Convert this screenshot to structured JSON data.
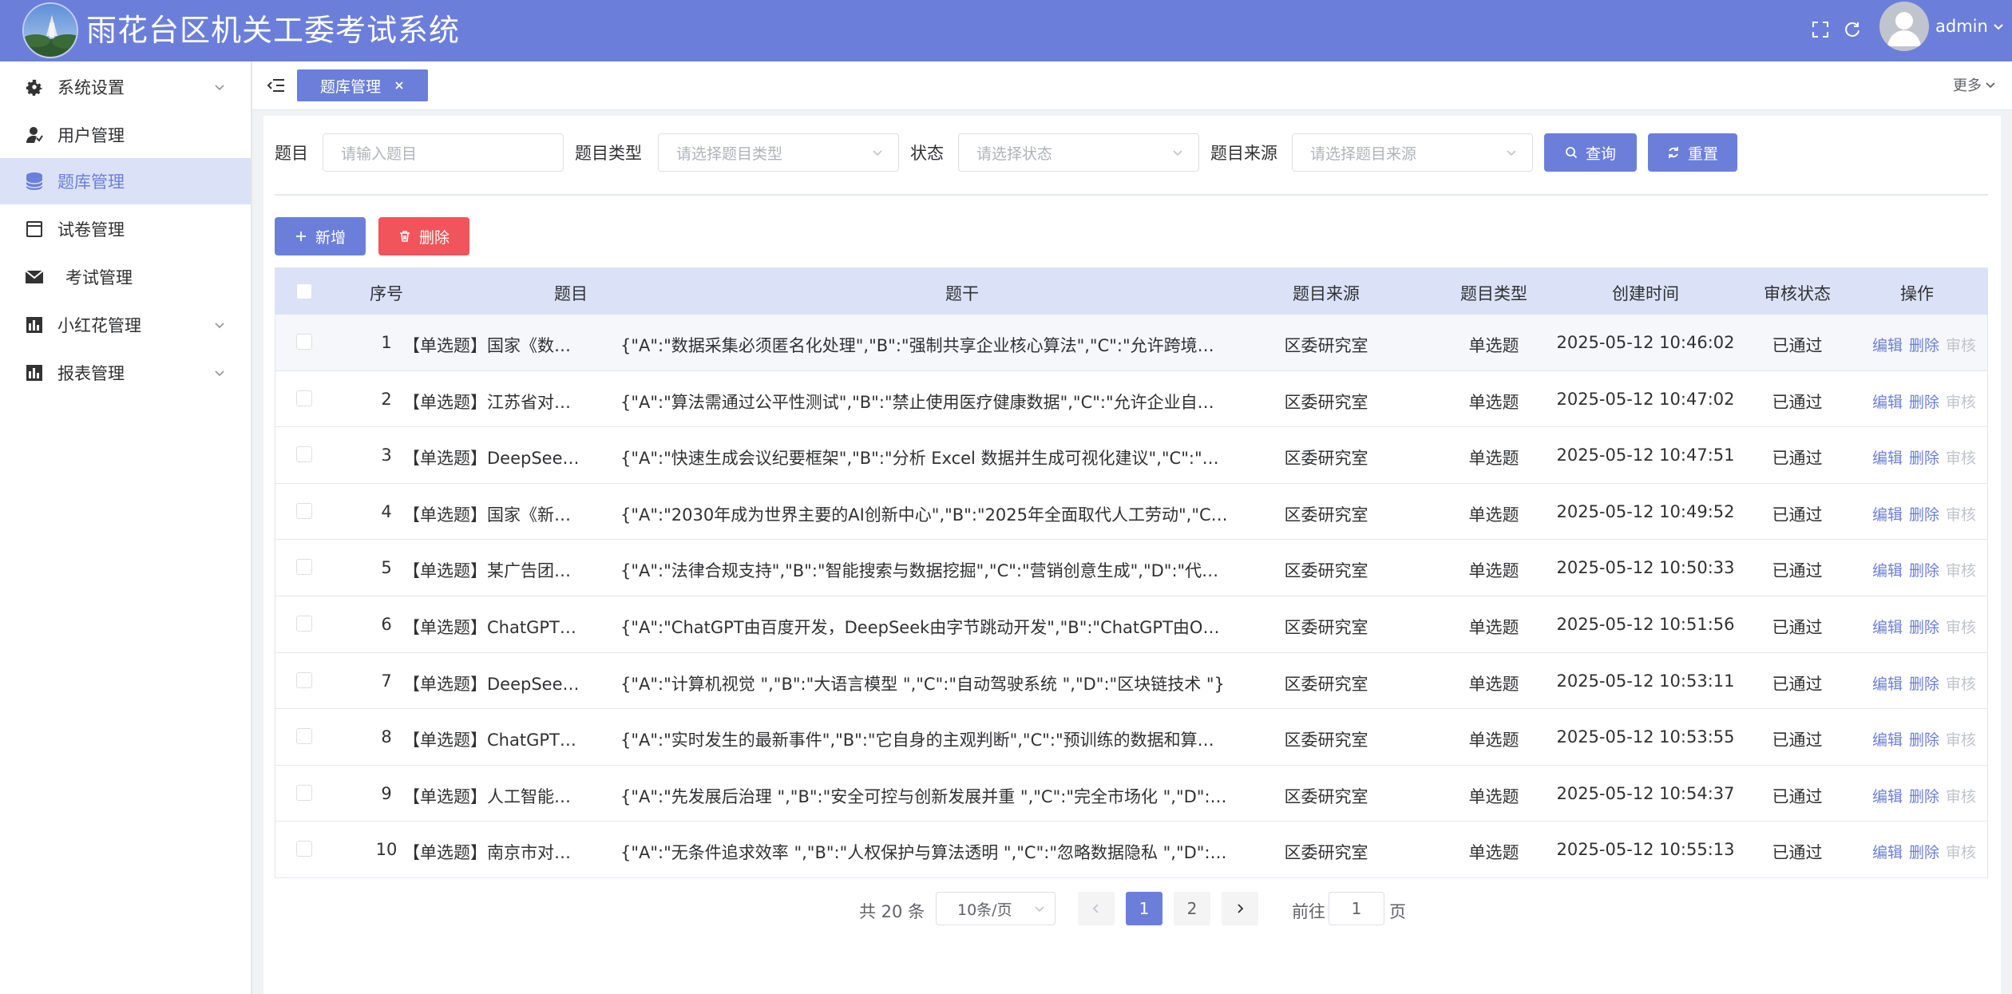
{
  "header": {
    "title": "雨花台区机关工委考试系统",
    "user": "admin"
  },
  "sidebar": {
    "items": [
      {
        "label": "系统设置",
        "icon": "gear-icon",
        "has_arrow": true
      },
      {
        "label": "用户管理",
        "icon": "user-icon",
        "has_arrow": false
      },
      {
        "label": "题库管理",
        "icon": "database-icon",
        "has_arrow": false,
        "active": true
      },
      {
        "label": "试卷管理",
        "icon": "calendar-icon",
        "has_arrow": false
      },
      {
        "label": "考试管理",
        "icon": "mail-icon",
        "has_arrow": false
      },
      {
        "label": "小红花管理",
        "icon": "bar-chart-icon",
        "has_arrow": true
      },
      {
        "label": "报表管理",
        "icon": "bar-chart-icon",
        "has_arrow": true
      }
    ]
  },
  "tabs": {
    "active": "题库管理",
    "more": "更多"
  },
  "filters": {
    "title_label": "题目",
    "title_placeholder": "请输入题目",
    "type_label": "题目类型",
    "type_placeholder": "请选择题目类型",
    "status_label": "状态",
    "status_placeholder": "请选择状态",
    "source_label": "题目来源",
    "source_placeholder": "请选择题目来源",
    "query_label": "查询",
    "reset_label": "重置"
  },
  "actions": {
    "add_label": "新增",
    "delete_label": "删除"
  },
  "table": {
    "headers": [
      "序号",
      "题目",
      "题干",
      "题目来源",
      "题目类型",
      "创建时间",
      "审核状态",
      "操作"
    ],
    "op_labels": {
      "edit": "编辑",
      "delete": "删除",
      "audit": "审核"
    },
    "rows": [
      {
        "no": "1",
        "title": "【单选题】国家《数…",
        "stem": "{\"A\":\"数据采集必须匿名化处理\",\"B\":\"强制共享企业核心算法\",\"C\":\"允许跨境…",
        "source": "区委研究室",
        "type": "单选题",
        "time": "2025-05-12 10:46:02",
        "status": "已通过"
      },
      {
        "no": "2",
        "title": "【单选题】江苏省对…",
        "stem": "{\"A\":\"算法需通过公平性测试\",\"B\":\"禁止使用医疗健康数据\",\"C\":\"允许企业自…",
        "source": "区委研究室",
        "type": "单选题",
        "time": "2025-05-12 10:47:02",
        "status": "已通过"
      },
      {
        "no": "3",
        "title": "【单选题】DeepSee…",
        "stem": "{\"A\":\"快速生成会议纪要框架\",\"B\":\"分析 Excel 数据并生成可视化建议\",\"C\":\"…",
        "source": "区委研究室",
        "type": "单选题",
        "time": "2025-05-12 10:47:51",
        "status": "已通过"
      },
      {
        "no": "4",
        "title": "【单选题】国家《新…",
        "stem": "{\"A\":\"2030年成为世界主要的AI创新中心\",\"B\":\"2025年全面取代人工劳动\",\"C…",
        "source": "区委研究室",
        "type": "单选题",
        "time": "2025-05-12 10:49:52",
        "status": "已通过"
      },
      {
        "no": "5",
        "title": "【单选题】某广告团…",
        "stem": "{\"A\":\"法律合规支持\",\"B\":\"智能搜索与数据挖掘\",\"C\":\"营销创意生成\",\"D\":\"代…",
        "source": "区委研究室",
        "type": "单选题",
        "time": "2025-05-12 10:50:33",
        "status": "已通过"
      },
      {
        "no": "6",
        "title": "【单选题】ChatGPT…",
        "stem": "{\"A\":\"ChatGPT由百度开发，DeepSeek由字节跳动开发\",\"B\":\"ChatGPT由O…",
        "source": "区委研究室",
        "type": "单选题",
        "time": "2025-05-12 10:51:56",
        "status": "已通过"
      },
      {
        "no": "7",
        "title": "【单选题】DeepSee…",
        "stem": "{\"A\":\"计算机视觉 \",\"B\":\"大语言模型 \",\"C\":\"自动驾驶系统 \",\"D\":\"区块链技术 \"}",
        "source": "区委研究室",
        "type": "单选题",
        "time": "2025-05-12 10:53:11",
        "status": "已通过"
      },
      {
        "no": "8",
        "title": "【单选题】ChatGPT…",
        "stem": "{\"A\":\"实时发生的最新事件\",\"B\":\"它自身的主观判断\",\"C\":\"预训练的数据和算…",
        "source": "区委研究室",
        "type": "单选题",
        "time": "2025-05-12 10:53:55",
        "status": "已通过"
      },
      {
        "no": "9",
        "title": "【单选题】人工智能…",
        "stem": "{\"A\":\"先发展后治理 \",\"B\":\"安全可控与创新发展并重 \",\"C\":\"完全市场化 \",\"D\":\"…",
        "source": "区委研究室",
        "type": "单选题",
        "time": "2025-05-12 10:54:37",
        "status": "已通过"
      },
      {
        "no": "10",
        "title": "【单选题】南京市对…",
        "stem": "{\"A\":\"无条件追求效率 \",\"B\":\"人权保护与算法透明 \",\"C\":\"忽略数据隐私 \",\"D\":\"…",
        "source": "区委研究室",
        "type": "单选题",
        "time": "2025-05-12 10:55:13",
        "status": "已通过"
      }
    ]
  },
  "pagination": {
    "total": "共 20 条",
    "page_size": "10条/页",
    "pages": [
      "1",
      "2"
    ],
    "current": "1",
    "goto_prefix": "前往",
    "goto_value": "1",
    "goto_suffix": "页"
  },
  "colors": {
    "primary": "#6b7fda",
    "danger": "#f2545b",
    "active_menu_bg": "#dbe2f7"
  }
}
